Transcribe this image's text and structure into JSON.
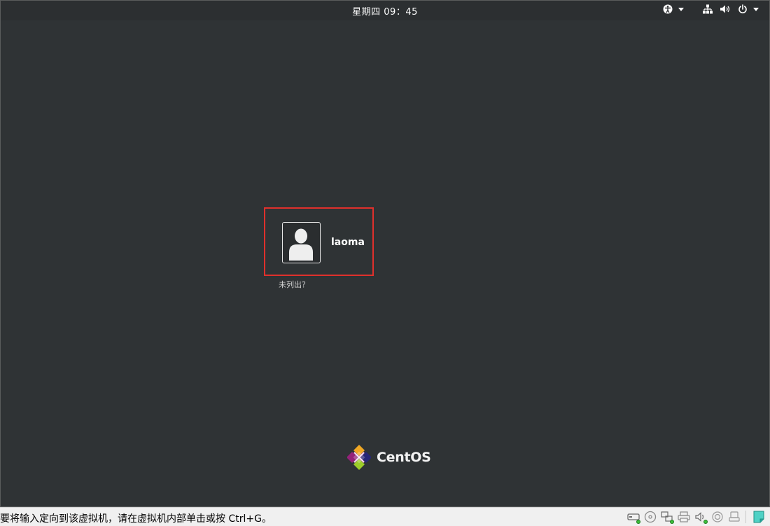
{
  "top_bar": {
    "clock": "星期四  09：45"
  },
  "login": {
    "username": "laoma",
    "not_listed": "未列出？"
  },
  "brand": {
    "name": "CentOS"
  },
  "status_bar": {
    "hint": "要将输入定向到该虚拟机，请在虚拟机内部单击或按 Ctrl+G。"
  },
  "icons": {
    "accessibility": "accessibility-icon",
    "network": "network-icon",
    "volume": "volume-icon",
    "power": "power-icon",
    "user": "user-avatar-icon",
    "logo": "centos-logo",
    "devices": [
      "hard-disk-icon",
      "cd-icon",
      "network-adapter-icon",
      "printer-icon",
      "sound-icon",
      "usb-icon",
      "device-icon",
      "notes-icon"
    ]
  },
  "colors": {
    "background": "#2f3335",
    "highlight_border": "#e0302c",
    "text": "#ffffff",
    "status_bar": "#f0f0f0"
  }
}
